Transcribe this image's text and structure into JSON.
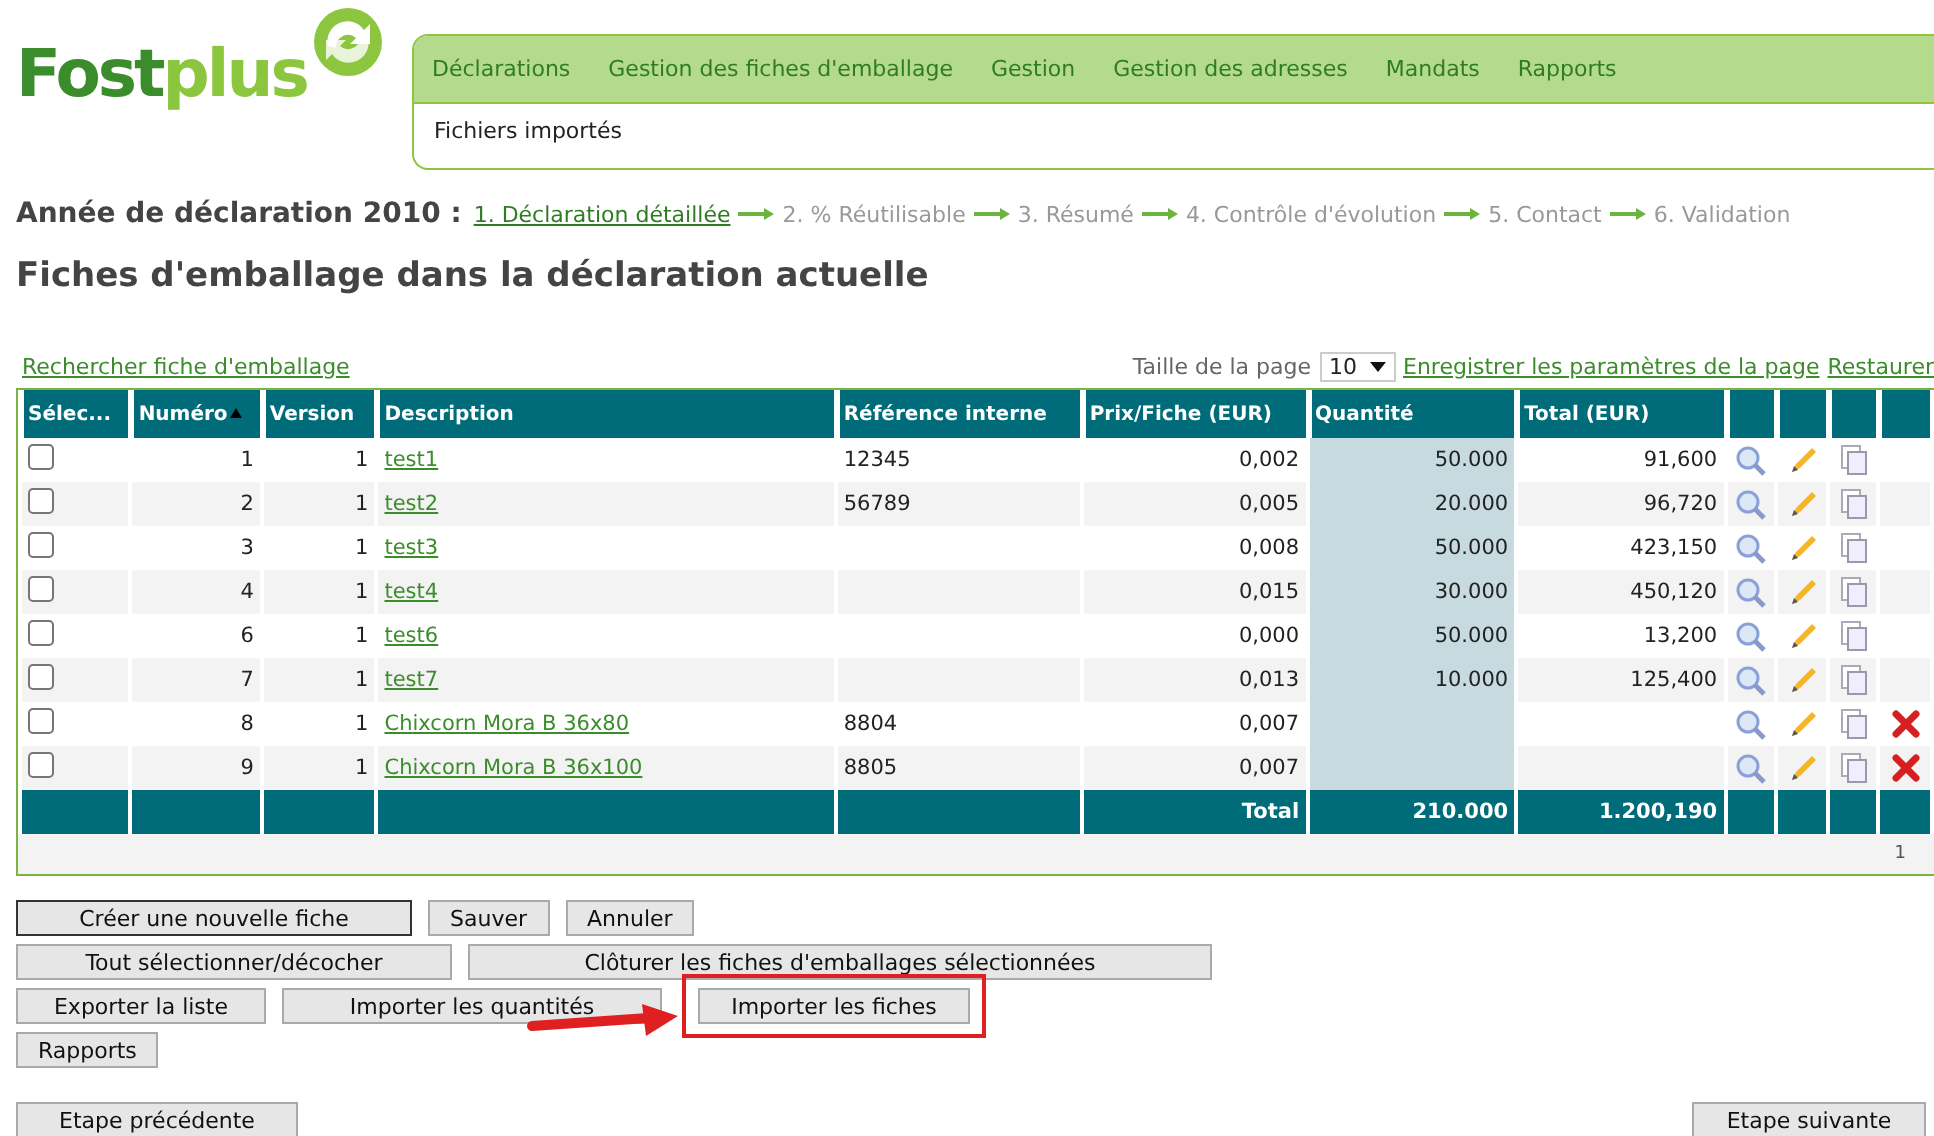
{
  "logo": {
    "dark": "Fost",
    "light": "plus"
  },
  "nav": {
    "items": [
      {
        "label": "Déclarations"
      },
      {
        "label": "Gestion des fiches d'emballage"
      },
      {
        "label": "Gestion"
      },
      {
        "label": "Gestion des adresses"
      },
      {
        "label": "Mandats"
      },
      {
        "label": "Rapports"
      }
    ],
    "sub_items": [
      {
        "label": "Fichiers importés"
      }
    ]
  },
  "steps": {
    "title": "Année de déclaration 2010 :",
    "items": [
      {
        "label": "1. Déclaration détaillée",
        "selected": true
      },
      {
        "label": "2. % Réutilisable",
        "selected": false
      },
      {
        "label": "3. Résumé",
        "selected": false
      },
      {
        "label": "4. Contrôle d'évolution",
        "selected": false
      },
      {
        "label": "5. Contact",
        "selected": false
      },
      {
        "label": "6. Validation",
        "selected": false
      }
    ]
  },
  "heading": "Fiches d'emballage dans la déclaration actuelle",
  "toolbar": {
    "search_link": "Rechercher fiche d'emballage",
    "page_size_label": "Taille de la page",
    "page_size": "10",
    "save_link": "Enregistrer les paramètres de la page",
    "restore_link": "Restaurer"
  },
  "table": {
    "columns": [
      {
        "label": "Sélec...",
        "sorted": false
      },
      {
        "label": "Numéro",
        "sorted": true
      },
      {
        "label": "Version",
        "sorted": false
      },
      {
        "label": "Description",
        "sorted": false
      },
      {
        "label": "Référence interne",
        "sorted": false
      },
      {
        "label": "Prix/Fiche (EUR)",
        "sorted": false
      },
      {
        "label": "Quantité",
        "sorted": false
      },
      {
        "label": "Total (EUR)",
        "sorted": false
      }
    ],
    "rows": [
      {
        "selected": false,
        "number": "1",
        "version": "1",
        "description": "test1",
        "reference": "12345",
        "price": "0,002",
        "quantity": "50.000",
        "total": "91,600",
        "deletable": false
      },
      {
        "selected": false,
        "number": "2",
        "version": "1",
        "description": "test2",
        "reference": "56789",
        "price": "0,005",
        "quantity": "20.000",
        "total": "96,720",
        "deletable": false
      },
      {
        "selected": false,
        "number": "3",
        "version": "1",
        "description": "test3",
        "reference": "",
        "price": "0,008",
        "quantity": "50.000",
        "total": "423,150",
        "deletable": false
      },
      {
        "selected": false,
        "number": "4",
        "version": "1",
        "description": "test4",
        "reference": "",
        "price": "0,015",
        "quantity": "30.000",
        "total": "450,120",
        "deletable": false
      },
      {
        "selected": false,
        "number": "6",
        "version": "1",
        "description": "test6",
        "reference": "",
        "price": "0,000",
        "quantity": "50.000",
        "total": "13,200",
        "deletable": false
      },
      {
        "selected": false,
        "number": "7",
        "version": "1",
        "description": "test7",
        "reference": "",
        "price": "0,013",
        "quantity": "10.000",
        "total": "125,400",
        "deletable": false
      },
      {
        "selected": false,
        "number": "8",
        "version": "1",
        "description": "Chixcorn Mora B 36x80",
        "reference": "8804",
        "price": "0,007",
        "quantity": "",
        "total": "",
        "deletable": true
      },
      {
        "selected": false,
        "number": "9",
        "version": "1",
        "description": "Chixcorn Mora B 36x100",
        "reference": "8805",
        "price": "0,007",
        "quantity": "",
        "total": "",
        "deletable": true
      }
    ],
    "footer": {
      "label": "Total",
      "quantity": "210.000",
      "total": "1.200,190"
    },
    "pages": [
      "1"
    ]
  },
  "button_rows": [
    [
      {
        "label": "Créer une nouvelle fiche",
        "highlighted": false,
        "default": true
      },
      {
        "label": "Sauver",
        "highlighted": false,
        "default": false
      },
      {
        "label": "Annuler",
        "highlighted": false,
        "default": false
      }
    ],
    [
      {
        "label": "Tout sélectionner/décocher",
        "highlighted": false,
        "default": false
      },
      {
        "label": "Clôturer les fiches d'emballages sélectionnées",
        "highlighted": false,
        "default": false
      }
    ],
    [
      {
        "label": "Exporter la liste",
        "highlighted": false,
        "default": false
      },
      {
        "label": "Importer les quantités",
        "highlighted": false,
        "default": false
      },
      {
        "label": "Importer les fiches",
        "highlighted": true,
        "default": false
      }
    ],
    [
      {
        "label": "Rapports",
        "highlighted": false,
        "default": false
      }
    ]
  ],
  "nav_buttons": {
    "previous": "Etape précédente",
    "next": "Etape suivante"
  }
}
